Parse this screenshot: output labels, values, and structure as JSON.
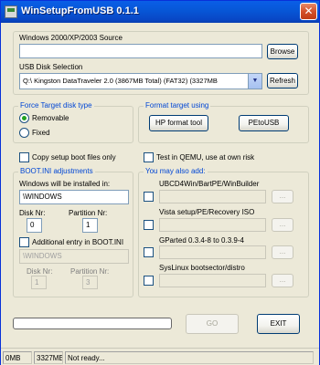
{
  "window": {
    "title": "WinSetupFromUSB 0.1.1",
    "close_glyph": "✕"
  },
  "source": {
    "label": "Windows 2000/XP/2003 Source",
    "path_value": "",
    "browse_label": "Browse"
  },
  "usb": {
    "label": "USB Disk Selection",
    "selected": "Q:\\ Kingston DataTraveler 2.0 (3867MB Total) (FAT32) (3327MB",
    "refresh_label": "Refresh",
    "arrow_glyph": "▼"
  },
  "force_target": {
    "title": "Force Target disk type",
    "options": [
      {
        "label": "Removable",
        "selected": true
      },
      {
        "label": "Fixed",
        "selected": false
      }
    ]
  },
  "format_target": {
    "title": "Format target using",
    "hp_label": "HP format tool",
    "pe_label": "PEtoUSB"
  },
  "options": {
    "copy_boot": "Copy setup boot files only",
    "test_qemu": "Test in QEMU, use at own risk"
  },
  "bootini": {
    "title": "BOOT.INI adjustments",
    "install_label": "Windows will be installed in:",
    "install_value": "\\WINDOWS",
    "disk_label": "Disk Nr:",
    "disk_value": "0",
    "partition_label": "Partition Nr:",
    "partition_value": "1",
    "additional_label": "Additional entry in BOOT.INI",
    "additional_value": "\\WINDOWS",
    "disk2_label": "Disk Nr:",
    "disk2_value": "1",
    "partition2_label": "Partition Nr:",
    "partition2_value": "3"
  },
  "also_add": {
    "title": "You may also add:",
    "items": [
      {
        "label": "UBCD4Win/BartPE/WinBuilder",
        "button": "..."
      },
      {
        "label": "Vista setup/PE/Recovery ISO",
        "button": "..."
      },
      {
        "label": "GParted 0.3.4-8 to 0.3.9-4",
        "button": "..."
      },
      {
        "label": "SysLinux bootsector/distro",
        "button": "..."
      }
    ]
  },
  "actions": {
    "progress": 0,
    "go_label": "GO",
    "exit_label": "EXIT"
  },
  "status": {
    "used": "0MB",
    "free": "3327MB",
    "message": "Not ready..."
  }
}
